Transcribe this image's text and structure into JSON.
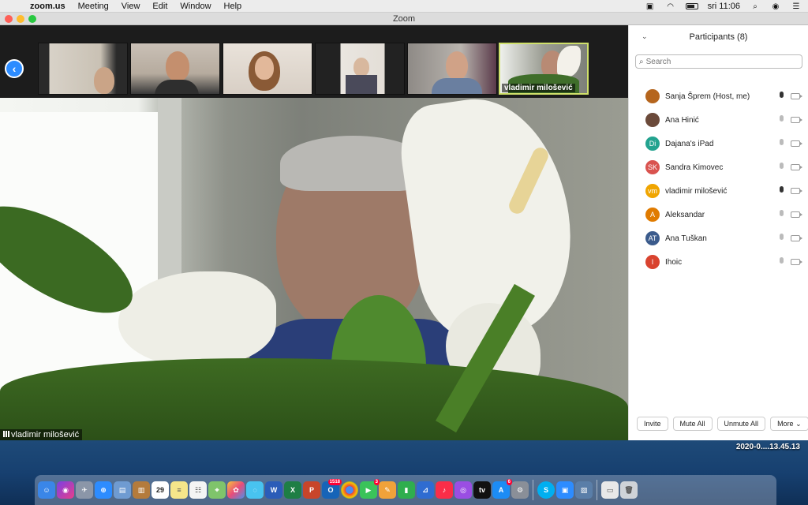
{
  "menubar": {
    "app": "zoom.us",
    "items": [
      "Meeting",
      "View",
      "Edit",
      "Window",
      "Help"
    ],
    "clock": "sri 11:06"
  },
  "window": {
    "title": "Zoom"
  },
  "thumbnails": [
    {
      "name": ""
    },
    {
      "name": ""
    },
    {
      "name": ""
    },
    {
      "name": ""
    },
    {
      "name": ""
    },
    {
      "name": "vladimir milošević",
      "active": true
    }
  ],
  "main_video": {
    "name": "vladimir milošević"
  },
  "panel": {
    "title": "Participants (8)",
    "search_placeholder": "Search",
    "participants": [
      {
        "initials": "",
        "name": "Sanja Šprem (Host, me)",
        "color": "#b5651d",
        "mic_live": true
      },
      {
        "initials": "",
        "name": "Ana Hinić",
        "color": "#6b4a3a",
        "mic_live": false
      },
      {
        "initials": "Di",
        "name": "Dajana's iPad",
        "color": "#23a38f",
        "mic_live": false
      },
      {
        "initials": "SK",
        "name": "Sandra Kimovec",
        "color": "#d9534f",
        "mic_live": false
      },
      {
        "initials": "vm",
        "name": "vladimir milošević",
        "color": "#f0a500",
        "mic_live": true
      },
      {
        "initials": "A",
        "name": "Aleksandar",
        "color": "#e07b00",
        "mic_live": false
      },
      {
        "initials": "AT",
        "name": "Ana Tuškan",
        "color": "#3b5b8c",
        "mic_live": false
      },
      {
        "initials": "I",
        "name": "Ihoic",
        "color": "#d9432f",
        "mic_live": false
      }
    ],
    "buttons": {
      "invite": "Invite",
      "mute_all": "Mute All",
      "unmute_all": "Unmute All",
      "more": "More ⌄"
    }
  },
  "desktop": {
    "file_label": "2020-0....13.45.13"
  },
  "dock": {
    "calendar_day": "29",
    "badges": {
      "outlook": "1518",
      "facetime": "3",
      "appstore": "6"
    }
  }
}
